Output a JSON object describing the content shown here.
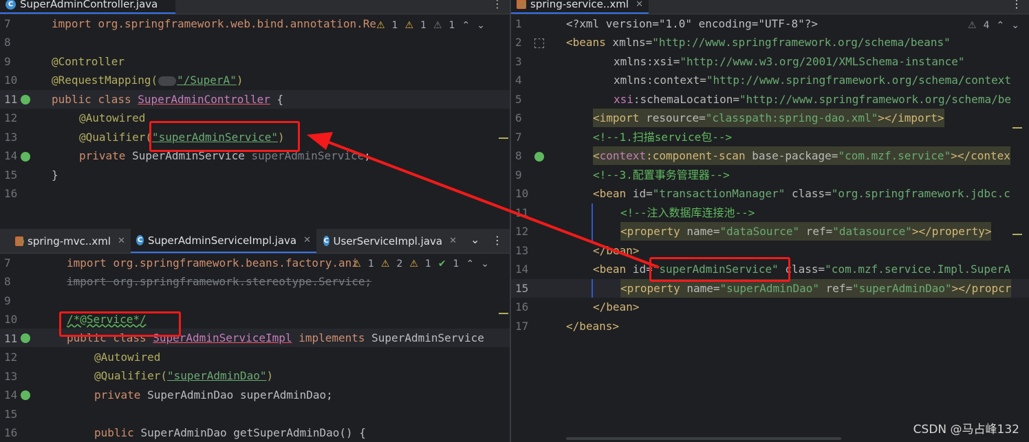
{
  "top_left": {
    "tab": "SuperAdminController.java",
    "inspections": [
      "1",
      "1",
      "1"
    ],
    "lines": [
      {
        "n": "7",
        "code": "import org.springframework.web.bind.annotation.Re"
      },
      {
        "n": "8",
        "code": ""
      },
      {
        "n": "9",
        "code": "@Controller"
      },
      {
        "n": "10",
        "code": "@RequestMapping(\"/SuperA\")"
      },
      {
        "n": "11",
        "code": "public class SuperAdminController {"
      },
      {
        "n": "12",
        "code": "@Autowired"
      },
      {
        "n": "13",
        "code": "@Qualifier(\"superAdminService\")"
      },
      {
        "n": "14",
        "code": "private SuperAdminService superAdminService;"
      },
      {
        "n": "15",
        "code": "}"
      },
      {
        "n": "16",
        "code": ""
      }
    ],
    "parts": {
      "kw_import": "import",
      "pkg": "org.springframework.web.bind.annotation.Re",
      "controller": "@Controller",
      "reqmap": "@RequestMapping(",
      "reqpath": "\"/SuperA\"",
      "rp": ")",
      "kw_public": "public",
      "kw_class": "class",
      "cls": "SuperAdminController",
      "brace": "{",
      "autowired": "@Autowired",
      "qual": "@Qualifier(",
      "qualval": "\"superAdminService\"",
      "qp": ")",
      "kw_private": "private",
      "ftype": "SuperAdminService",
      "fname": "superAdminService",
      "semi": ";",
      "close": "}"
    }
  },
  "bottom_left": {
    "tabs": [
      "spring-mvc..xml",
      "SuperAdminServiceImpl.java",
      "UserServiceImpl.java"
    ],
    "inspections": [
      "1",
      "2",
      "1",
      "1"
    ],
    "lines": [
      {
        "n": "7"
      },
      {
        "n": "8"
      },
      {
        "n": "9"
      },
      {
        "n": "10"
      },
      {
        "n": "11"
      },
      {
        "n": "12"
      },
      {
        "n": "13"
      },
      {
        "n": "14"
      },
      {
        "n": "15"
      },
      {
        "n": "16"
      }
    ],
    "parts": {
      "kw_import": "import",
      "pkg1": "org.springframework.beans.factory.ani",
      "import2": "import org.springframework.stereotype.Service;",
      "comment": "/*@Service*/",
      "kw_public": "public",
      "kw_class": "class",
      "cls": "SuperAdminServiceImpl",
      "kw_impl": "implements",
      "iface": "SuperAdminService",
      "autowired": "@Autowired",
      "qual": "@Qualifier(",
      "qualval": "\"superAdminDao\"",
      "qp": ")",
      "kw_private": "private",
      "ftype": "SuperAdminDao",
      "fname": "superAdminDao;",
      "getter": "SuperAdminDao getSuperAdminDao() {"
    }
  },
  "right": {
    "tab": "spring-service..xml",
    "inspections": [
      "4"
    ],
    "lines": [
      {
        "n": "1"
      },
      {
        "n": "2"
      },
      {
        "n": "3"
      },
      {
        "n": "4"
      },
      {
        "n": "5"
      },
      {
        "n": "6"
      },
      {
        "n": "7"
      },
      {
        "n": "8"
      },
      {
        "n": "9"
      },
      {
        "n": "10"
      },
      {
        "n": "11"
      },
      {
        "n": "12"
      },
      {
        "n": "13"
      },
      {
        "n": "14"
      },
      {
        "n": "15"
      },
      {
        "n": "16"
      },
      {
        "n": "17"
      }
    ],
    "parts": {
      "l1": "<?xml version=\"1.0\" encoding=\"UTF-8\"?>",
      "l2tag": "<beans",
      "l2attr": " xmlns=",
      "l2val": "\"http://www.springframework.org/schema/beans\"",
      "l3attr": "xmlns:",
      "l3ns": "xsi",
      "l3eq": "=",
      "l3val": "\"http://www.w3.org/2001/XMLSchema-instance\"",
      "l4attr": "xmlns:",
      "l4ns": "context",
      "l4eq": "=",
      "l4val": "\"http://www.springframework.org/schema/context",
      "l5ns": "xsi",
      "l5attr": ":schemaLocation=",
      "l5val": "\"http://www.springframework.org/schema/be",
      "l6a": "<",
      "l6tag": "import",
      "l6attr": " resource=",
      "l6val": "\"classpath:spring-dao.xml\"",
      "l6b": "></",
      "l6tag2": "import",
      "l6c": ">",
      "l7": "<!--1.扫描service包-->",
      "l8a": "<",
      "l8ns": "context",
      "l8tag": ":component-scan",
      "l8attr": " base-package=",
      "l8val": "\"com.mzf.service\"",
      "l8b": "></contex",
      "l9": "<!--3.配置事务管理器-->",
      "l10tag": "<bean",
      "l10attr1": " id=",
      "l10val1": "\"transactionManager\"",
      "l10attr2": " class=",
      "l10val2": "\"org.springframework.jdbc.c",
      "l11": "<!--注入数据库连接池-->",
      "l12a": "<",
      "l12tag": "property",
      "l12attr1": " name=",
      "l12val1": "\"dataSource\"",
      "l12attr2": " ref=",
      "l12val2": "\"datasource\"",
      "l12b": "></",
      "l12tag2": "property",
      "l12c": ">",
      "l13": "</bean>",
      "l14tag": "<bean",
      "l14attr1": " id=",
      "l14val1": "\"superAdminService\"",
      "l14attr2": " class=",
      "l14val2": "\"com.mzf.service.Impl.SuperA",
      "l15a": "<",
      "l15tag": "property",
      "l15attr1": " name=",
      "l15val1": "\"superAdminDao\"",
      "l15attr2": " ref=",
      "l15val2": "\"superAdminDao\"",
      "l15b": "></",
      "l15tag2": "propcr",
      "l16": "</bean>",
      "l17": "</beans>"
    }
  },
  "watermark": "CSDN @马占峰132",
  "colors": {
    "annotation_box": "#f21a1a",
    "bg": "#1e1f22",
    "keyword": "#cf8e6d",
    "string": "#6aab73",
    "tag": "#d5b778"
  }
}
